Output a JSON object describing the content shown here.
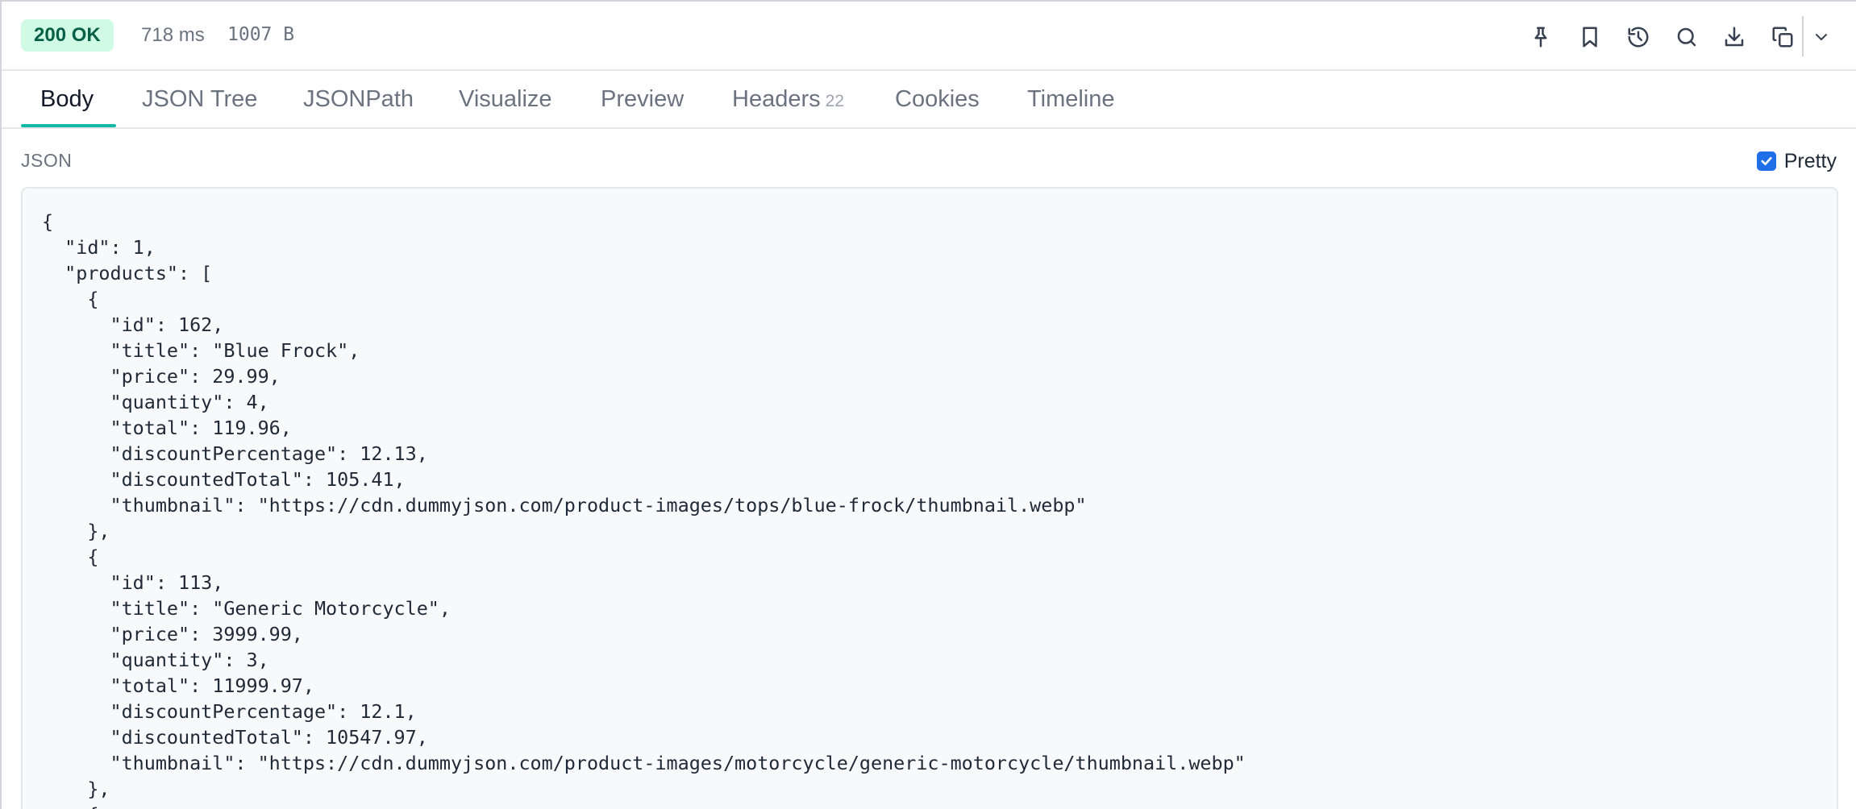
{
  "response": {
    "status": "200 OK",
    "time": "718 ms",
    "size": "1007 B"
  },
  "toolbar": {
    "buttons": [
      {
        "name": "pin-icon"
      },
      {
        "name": "bookmark-icon"
      },
      {
        "name": "history-icon"
      },
      {
        "name": "search-icon"
      },
      {
        "name": "download-icon"
      },
      {
        "name": "copy-icon"
      },
      {
        "name": "chevron-down-icon"
      }
    ]
  },
  "tabs": [
    {
      "label": "Body",
      "active": true
    },
    {
      "label": "JSON Tree"
    },
    {
      "label": "JSONPath"
    },
    {
      "label": "Visualize"
    },
    {
      "label": "Preview"
    },
    {
      "label": "Headers",
      "count": "22"
    },
    {
      "label": "Cookies"
    },
    {
      "label": "Timeline"
    }
  ],
  "body": {
    "format_label": "JSON",
    "pretty_label": "Pretty",
    "pretty_checked": true,
    "lines": [
      "{",
      "  \"id\": 1,",
      "  \"products\": [",
      "    {",
      "      \"id\": 162,",
      "      \"title\": \"Blue Frock\",",
      "      \"price\": 29.99,",
      "      \"quantity\": 4,",
      "      \"total\": 119.96,",
      "      \"discountPercentage\": 12.13,",
      "      \"discountedTotal\": 105.41,",
      "      \"thumbnail\": \"https://cdn.dummyjson.com/product-images/tops/blue-frock/thumbnail.webp\"",
      "    },",
      "    {",
      "      \"id\": 113,",
      "      \"title\": \"Generic Motorcycle\",",
      "      \"price\": 3999.99,",
      "      \"quantity\": 3,",
      "      \"total\": 11999.97,",
      "      \"discountPercentage\": 12.1,",
      "      \"discountedTotal\": 10547.97,",
      "      \"thumbnail\": \"https://cdn.dummyjson.com/product-images/motorcycle/generic-motorcycle/thumbnail.webp\"",
      "    },",
      "    {"
    ]
  },
  "colors": {
    "status_bg": "#d1fae5",
    "status_text": "#065f46",
    "tab_accent": "#14b8a6",
    "checkbox": "#1e6fe8"
  }
}
